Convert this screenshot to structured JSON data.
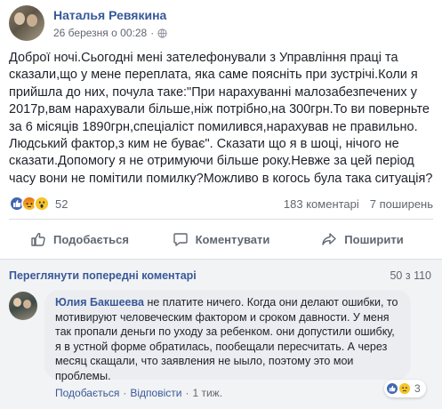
{
  "post": {
    "author": "Наталья Ревякина",
    "date": "26 березня о 00:28",
    "text": "Доброї ночі.Сьогодні мені зателефонували з Управління праці та сказали,що у мене переплата, яка саме поясніть при зустрічі.Коли я прийшла до них, почула таке:\"При нарахуванні малозабезпечених у 2017р,вам нарахували більше,ніж потрібно,на 300грн.То ви поверньте за 6 місяців 1890грн,спеціаліст помилився,нарахував не правильно. Людський фактор,з ким не буває\". Сказати що я в шоці, нічого не сказати.Допомогу я не отримуючи більше року.Невже за цей період часу вони не помітили помилку?Можливо в когось була така ситуація?",
    "reaction_count": "52",
    "comments_count": "183 коментарі",
    "shares_count": "7 поширень",
    "reaction_icons": [
      "like-icon",
      "angry-icon",
      "wow-icon"
    ]
  },
  "actions": {
    "like": "Подобається",
    "comment": "Коментувати",
    "share": "Поширити"
  },
  "comments": {
    "prev_link": "Переглянути попередні коментарі",
    "counter": "50 з 110",
    "items": [
      {
        "author": "Юлия Бакшеева",
        "text": "не платите ничего. Когда они делают ошибки, то мотивируют человеческим фактором и сроком давности. У меня так пропали деньги по уходу за ребенком. они допустили ошибку, я в устной форме обратилась, пообещали пересчитать. А через месяц скащали, что заявления не ыыло, поэтому это мои проблемы.",
        "like_label": "Подобається",
        "reply_label": "Відповісти",
        "time": "1 тиж.",
        "reaction_count": "3",
        "sep": "·"
      }
    ]
  },
  "colors": {
    "link": "#385898",
    "like": "#4267b2",
    "muted": "#606770"
  }
}
